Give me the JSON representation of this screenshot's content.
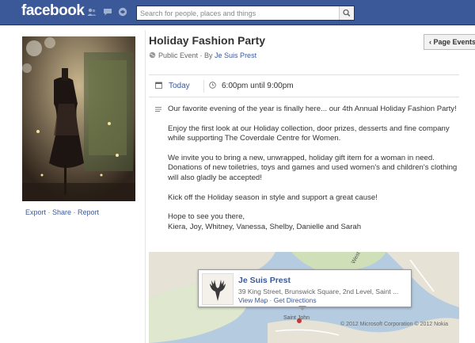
{
  "header": {
    "logo": "facebook",
    "search_placeholder": "Search for people, places and things"
  },
  "event": {
    "title": "Holiday Fashion Party",
    "visibility": "Public Event",
    "by_prefix": " · By ",
    "host": "Je Suis Prest",
    "page_events_button": "Page Events",
    "date_label": "Today",
    "time_label": "6:00pm until 9:00pm",
    "description": [
      "Our favorite evening of the year is finally here... our 4th Annual Holiday Fashion Party!",
      "Enjoy the first look at our Holiday collection, door prizes, desserts and fine company while supporting The Coverdale Centre for Women.",
      "We invite you to bring a new, unwrapped, holiday gift item for a woman in need. Donations of new toiletries, toys and games and used women's and children's clothing will also gladly be accepted!",
      "Kick off the Holiday season in style and support a great cause!",
      "Hope to see you there,\nKiera, Joy, Whitney, Vanessa, Shelby, Danielle and Sarah"
    ]
  },
  "left_links": {
    "export": "Export",
    "share": "Share",
    "report": "Report",
    "sep": " · "
  },
  "map": {
    "place_name": "Je Suis Prest",
    "address": "39 King Street, Brunswick Square, 2nd Level, Saint ...",
    "view_map": "View Map",
    "get_directions": "Get Directions",
    "sep": " · ",
    "labels": {
      "west": "West",
      "saint_john": "Saint John"
    },
    "copyright": "© 2012 Microsoft Corporation © 2012 Nokia"
  },
  "colors": {
    "brand": "#3b5998",
    "text": "#333333",
    "muted": "#666666"
  },
  "icons": [
    "friend-requests-icon",
    "messages-icon",
    "notifications-icon",
    "search-icon",
    "globe-icon",
    "calendar-icon",
    "clock-icon",
    "info-icon"
  ]
}
